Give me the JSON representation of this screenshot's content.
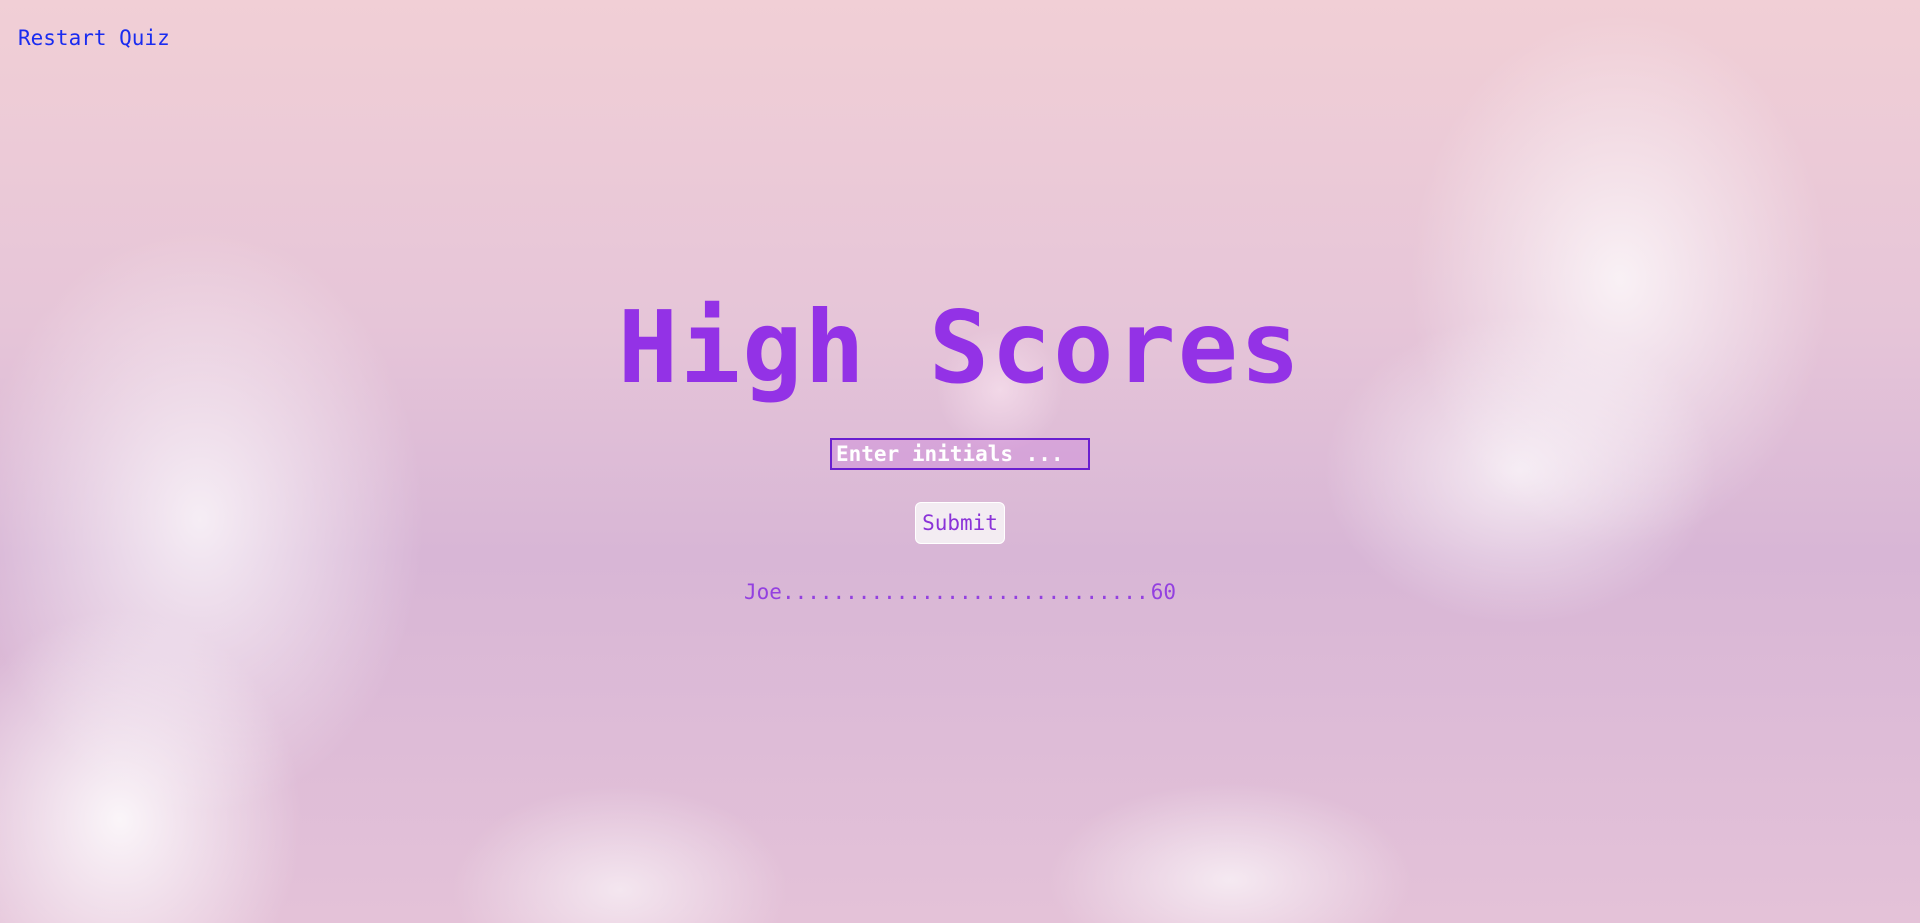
{
  "nav": {
    "restart_label": "Restart Quiz"
  },
  "title": "High Scores",
  "form": {
    "initials_placeholder": "Enter initials ...",
    "initials_value": "",
    "submit_label": "Submit"
  },
  "scores": [
    {
      "name": "Joe",
      "dots": "..............................",
      "score": "60"
    }
  ],
  "colors": {
    "accent": "#9332e6",
    "link": "#1a2cf0",
    "input_border": "#6a1fd0"
  }
}
